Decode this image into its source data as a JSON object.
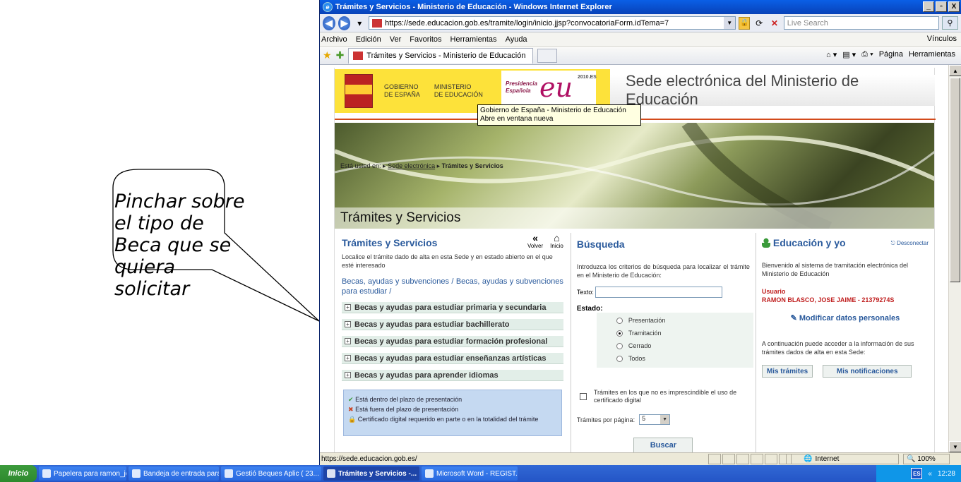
{
  "callout": {
    "text": "Pinchar sobre el tipo de Beca que se quiera solicitar"
  },
  "window": {
    "title": "Trámites y Servicios - Ministerio de Educación - Windows Internet Explorer",
    "controls": [
      "_",
      "▫",
      "X"
    ]
  },
  "address": {
    "url": "https://sede.educacion.gob.es/tramite/login/inicio.jjsp?convocatoriaForm.idTema=7",
    "search_placeholder": "Live Search"
  },
  "menu": {
    "items": [
      "Archivo",
      "Edición",
      "Ver",
      "Favoritos",
      "Herramientas",
      "Ayuda"
    ],
    "links": "Vínculos"
  },
  "tabs": {
    "active": "Trámites y Servicios - Ministerio de Educación",
    "tools": [
      "Página",
      "Herramientas"
    ]
  },
  "banner": {
    "gobierno": "GOBIERNO\nDE ESPAÑA",
    "ministerio": "MINISTERIO\nDE EDUCACIÓN",
    "presidencia": "Presidencia\nEspañola",
    "eu": "eu",
    "year": "2010.ES",
    "title": "Sede electrónica del Ministerio de Educación",
    "tooltip": "Gobierno de España - Ministerio de Educación Abre en ventana nueva"
  },
  "breadcrumb": {
    "prefix": "Está usted en:",
    "home": "Sede electrónica",
    "current": "Trámites y Servicios"
  },
  "hero_title": "Trámites y Servicios",
  "tramites": {
    "title": "Trámites y Servicios",
    "volver": "Volver",
    "inicio": "Inicio",
    "intro": "Localice el trámite dado de alta en esta Sede y en estado abierto en el que esté interesado",
    "path": "Becas, ayudas y subvenciones / Becas, ayudas y subvenciones para estudiar /",
    "categories": [
      "Becas y ayudas para estudiar primaria y secundaria",
      "Becas y ayudas para estudiar bachillerato",
      "Becas y ayudas para estudiar formación profesional",
      "Becas y ayudas para estudiar enseñanzas artísticas",
      "Becas y ayudas para aprender idiomas"
    ],
    "legend": [
      "Está dentro del plazo de presentación",
      "Está fuera del plazo de presentación",
      "Certificado digital requerido en parte o en la totalidad del trámite"
    ]
  },
  "busqueda": {
    "title": "Búsqueda",
    "intro": "Introduzca los criterios de búsqueda para localizar el trámite en el Ministerio de Educación:",
    "texto_label": "Texto:",
    "estado_label": "Estado:",
    "options": [
      "Presentación",
      "Tramitación",
      "Cerrado",
      "Todos"
    ],
    "selected": "Tramitación",
    "checkbox_label": "Trámites en los que no es imprescindible el uso de certificado digital",
    "perpage_label": "Trámites por página:",
    "perpage_value": "5",
    "button": "Buscar"
  },
  "edu": {
    "title": "Educación y yo",
    "desconectar": "Desconectar",
    "welcome": "Bienvenido al sistema de tramitación electrónica del Ministerio de Educación",
    "user_label": "Usuario",
    "user_name": "RAMON BLASCO, JOSE JAIME - 21379274S",
    "modificar": "Modificar datos personales",
    "access": "A continuación puede acceder a la información de sus trámites dados de alta en esta Sede:",
    "btn_tramites": "Mis trámites",
    "btn_notificaciones": "Mis notificaciones"
  },
  "status": {
    "text": "https://sede.educacion.gob.es/",
    "zone": "Internet",
    "zoom": "100%"
  },
  "taskbar": {
    "start": "Inicio",
    "tasks": [
      "Papelera para ramon_jos...",
      "Bandeja de entrada para...",
      "Gestió Beques Aplic ( 23...",
      "Trámites y Servicios -...",
      "Microsoft Word - REGIST..."
    ],
    "lang": "ES",
    "time": "12:28"
  }
}
